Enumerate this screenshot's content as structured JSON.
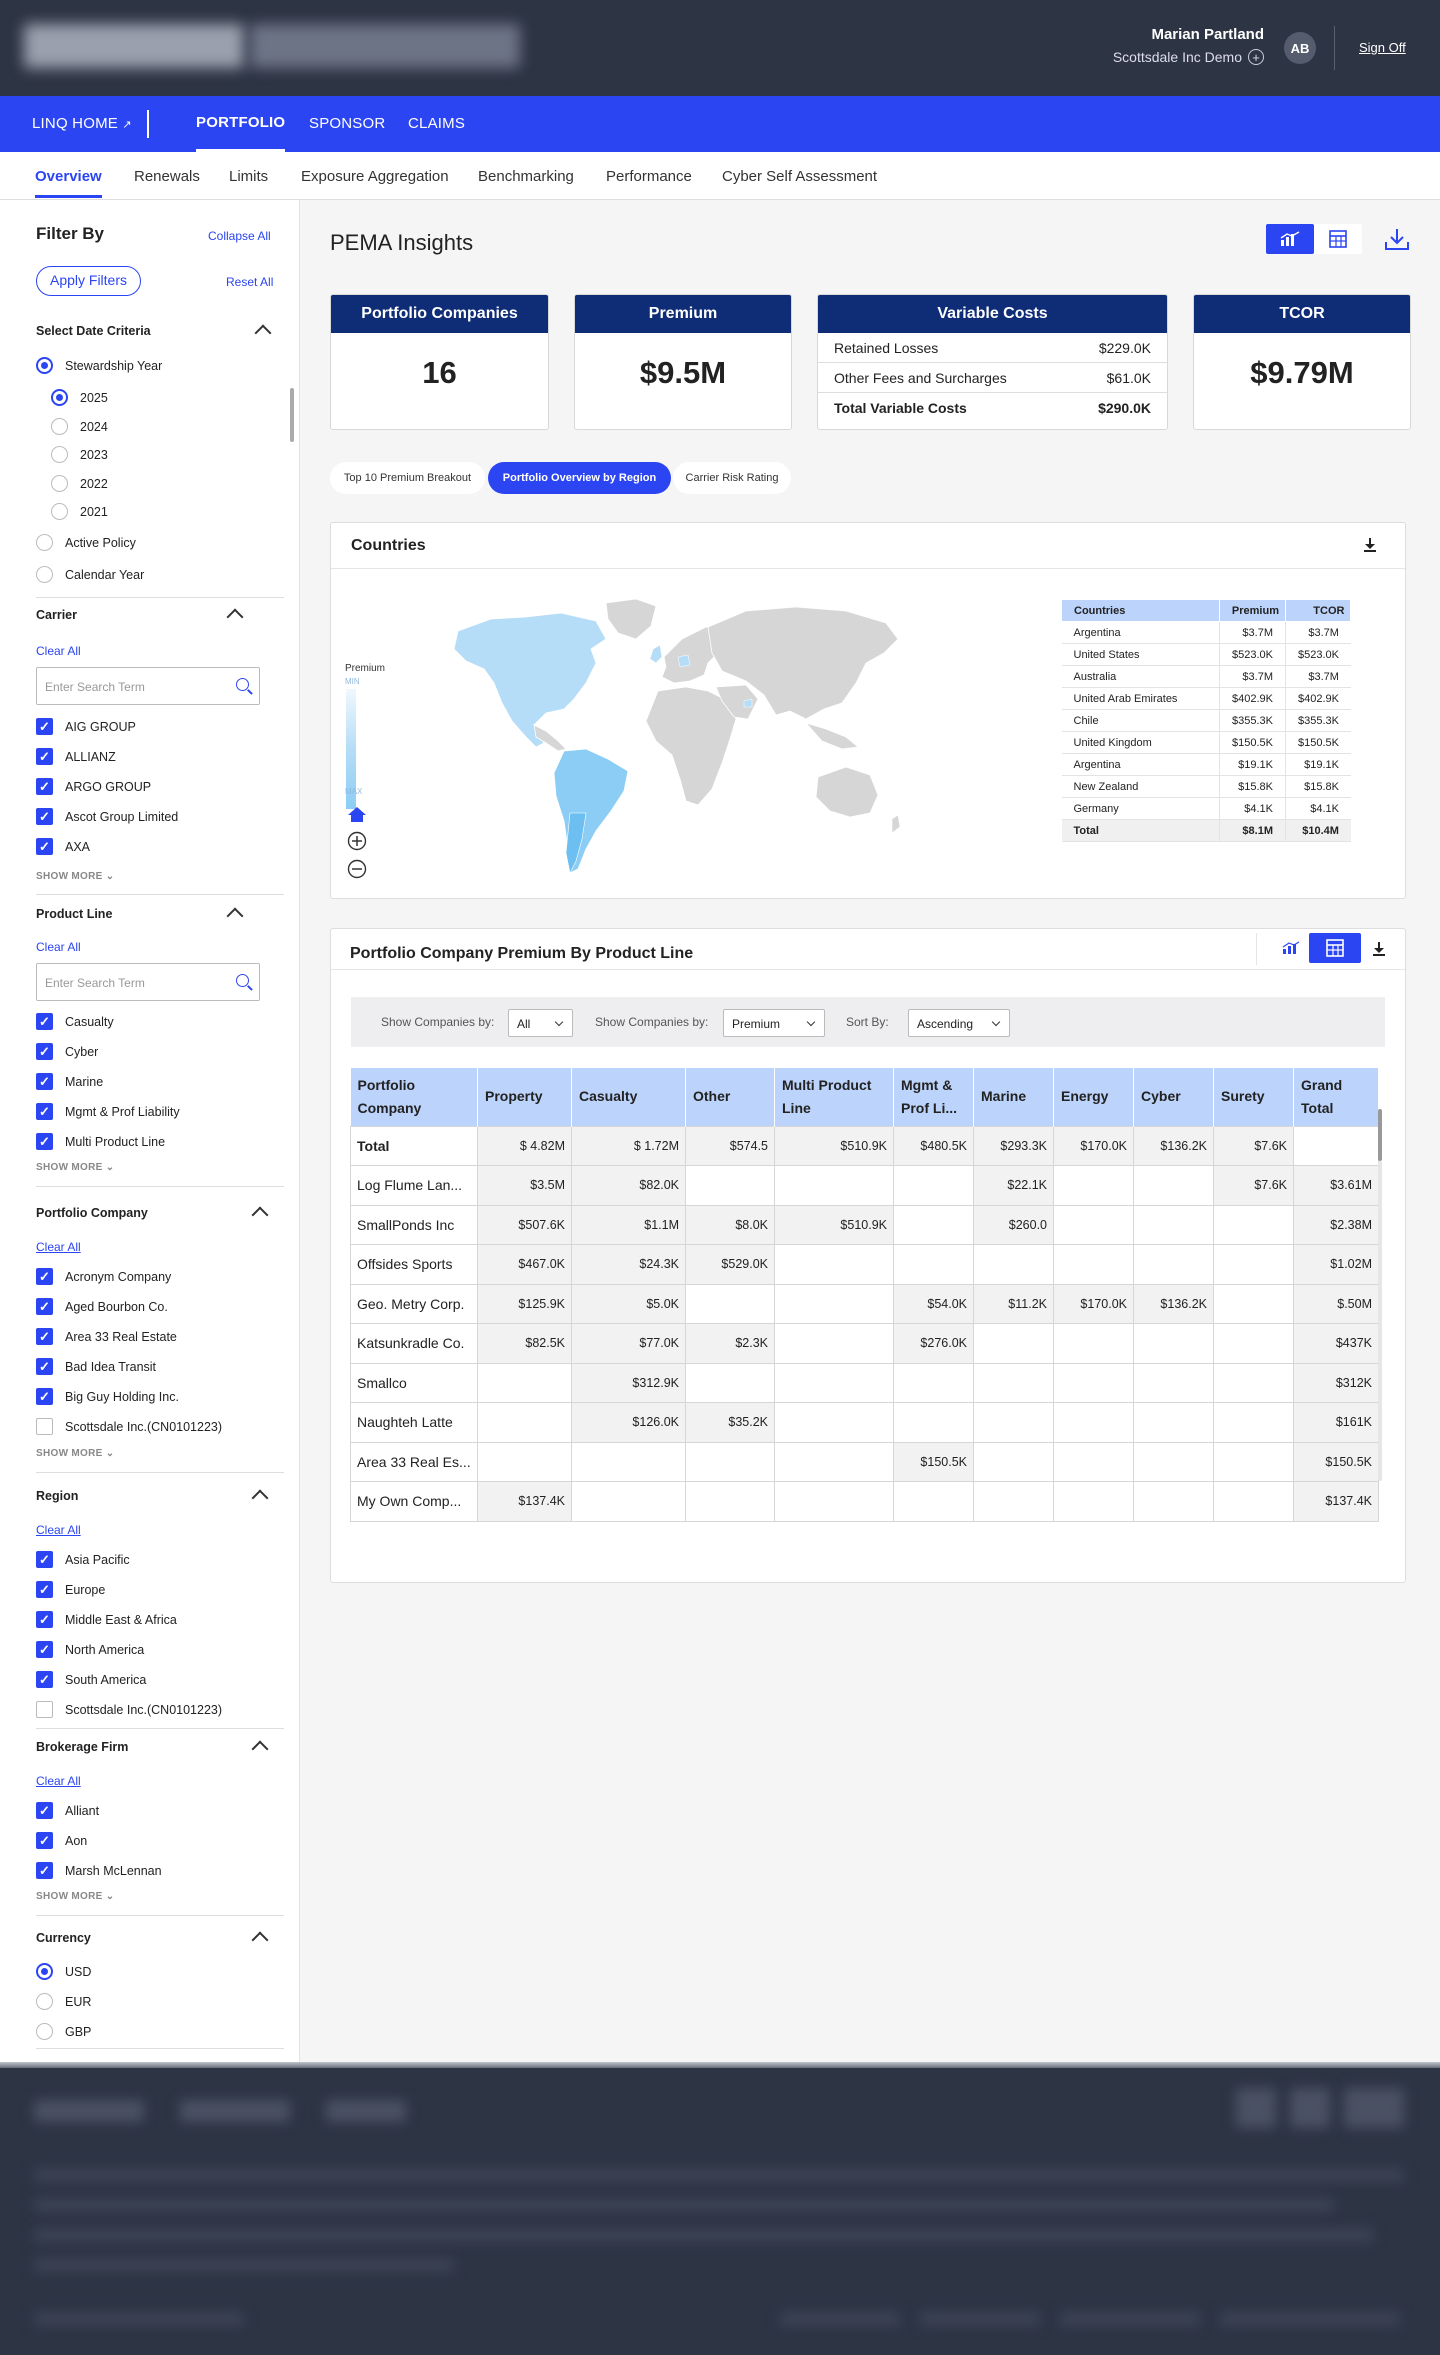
{
  "header": {
    "user_name": "Marian Partland",
    "company": "Scottsdale Inc Demo",
    "avatar": "AB",
    "signoff": "Sign Off"
  },
  "nav": {
    "linq_home": "LINQ HOME",
    "items": [
      "PORTFOLIO",
      "SPONSOR",
      "CLAIMS"
    ],
    "active": "PORTFOLIO"
  },
  "subnav": {
    "items": [
      "Overview",
      "Renewals",
      "Limits",
      "Exposure Aggregation",
      "Benchmarking",
      "Performance",
      "Cyber Self Assessment"
    ],
    "active": "Overview"
  },
  "sidebar": {
    "title": "Filter By",
    "collapse_all": "Collapse All",
    "apply_filters": "Apply Filters",
    "reset_all": "Reset All",
    "clear_all": "Clear All",
    "search_placeholder": "Enter Search Term",
    "show_more": "SHOW MORE",
    "date_criteria": {
      "title": "Select Date Criteria",
      "stewardship": "Stewardship Year",
      "years": [
        "2025",
        "2024",
        "2023",
        "2022",
        "2021"
      ],
      "selected_year": "2025",
      "active_policy": "Active Policy",
      "calendar_year": "Calendar Year"
    },
    "carrier": {
      "title": "Carrier",
      "items": [
        "AIG GROUP",
        "ALLIANZ",
        "ARGO GROUP",
        "Ascot Group Limited",
        "AXA"
      ]
    },
    "product_line": {
      "title": "Product Line",
      "items": [
        "Casualty",
        "Cyber",
        "Marine",
        "Mgmt & Prof Liability",
        "Multi Product Line"
      ]
    },
    "portfolio_company": {
      "title": "Portfolio Company",
      "items": [
        "Acronym Company",
        "Aged Bourbon Co.",
        "Area 33 Real Estate",
        "Bad Idea Transit",
        "Big Guy Holding Inc.",
        "Scottsdale Inc.(CN0101223)"
      ],
      "checked": [
        true,
        true,
        true,
        true,
        true,
        false
      ]
    },
    "region": {
      "title": "Region",
      "items": [
        "Asia Pacific",
        "Europe",
        "Middle East & Africa",
        "North America",
        "South America",
        "Scottsdale Inc.(CN0101223)"
      ],
      "checked": [
        true,
        true,
        true,
        true,
        true,
        false
      ]
    },
    "brokerage": {
      "title": "Brokerage Firm",
      "items": [
        "Alliant",
        "Aon",
        "Marsh McLennan"
      ]
    },
    "currency": {
      "title": "Currency",
      "items": [
        "USD",
        "EUR",
        "GBP"
      ],
      "selected": "USD"
    }
  },
  "main": {
    "title": "PEMA Insights",
    "cards": {
      "portfolio_companies": {
        "label": "Portfolio Companies",
        "value": "16"
      },
      "premium": {
        "label": "Premium",
        "value": "$9.5M"
      },
      "variable_costs": {
        "label": "Variable Costs",
        "rows": [
          {
            "label": "Retained Losses",
            "value": "$229.0K"
          },
          {
            "label": "Other Fees and Surcharges",
            "value": "$61.0K"
          },
          {
            "label": "Total Variable Costs",
            "value": "$290.0K"
          }
        ]
      },
      "tcor": {
        "label": "TCOR",
        "value": "$9.79M"
      }
    },
    "pills": [
      "Top 10 Premium Breakout",
      "Portfolio Overview by Region",
      "Carrier Risk Rating"
    ],
    "active_pill": "Portfolio Overview by Region",
    "countries": {
      "title": "Countries",
      "legend_title": "Premium",
      "legend_min": "MIN",
      "legend_max": "MAX",
      "columns": [
        "Countries",
        "Premium",
        "TCOR"
      ],
      "rows": [
        [
          "Argentina",
          "$3.7M",
          "$3.7M"
        ],
        [
          "United States",
          "$523.0K",
          "$523.0K"
        ],
        [
          "Australia",
          "$3.7M",
          "$3.7M"
        ],
        [
          "United Arab Emirates",
          "$402.9K",
          "$402.9K"
        ],
        [
          "Chile",
          "$355.3K",
          "$355.3K"
        ],
        [
          "United Kingdom",
          "$150.5K",
          "$150.5K"
        ],
        [
          "Argentina",
          "$19.1K",
          "$19.1K"
        ],
        [
          "New Zealand",
          "$15.8K",
          "$15.8K"
        ],
        [
          "Germany",
          "$4.1K",
          "$4.1K"
        ]
      ],
      "total": [
        "Total",
        "$8.1M",
        "$10.4M"
      ]
    },
    "product_line": {
      "title": "Portfolio Company Premium By Product Line",
      "filters": {
        "show_by_label": "Show Companies by:",
        "show_by_value": "All",
        "show_by2_label": "Show Companies by:",
        "show_by2_value": "Premium",
        "sort_label": "Sort By:",
        "sort_value": "Ascending"
      },
      "columns": [
        "Portfolio Company",
        "Property",
        "Casualty",
        "Other",
        "Multi Product Line",
        "Mgmt & Prof Li...",
        "Marine",
        "Energy",
        "Cyber",
        "Surety",
        "Grand Total"
      ],
      "rows": [
        [
          "Total",
          "$ 4.82M",
          "$ 1.72M",
          "$574.5",
          "$510.9K",
          "$480.5K",
          "$293.3K",
          "$170.0K",
          "$136.2K",
          "$7.6K",
          ""
        ],
        [
          "Log Flume Lan...",
          "$3.5M",
          "$82.0K",
          "",
          "",
          "",
          "$22.1K",
          "",
          "",
          "$7.6K",
          "$3.61M"
        ],
        [
          "SmallPonds Inc",
          "$507.6K",
          "$1.1M",
          "$8.0K",
          "$510.9K",
          "",
          "$260.0",
          "",
          "",
          "",
          "$2.38M"
        ],
        [
          "Offsides Sports",
          "$467.0K",
          "$24.3K",
          "$529.0K",
          "",
          "",
          "",
          "",
          "",
          "",
          "$1.02M"
        ],
        [
          "Geo. Metry Corp.",
          "$125.9K",
          "$5.0K",
          "",
          "",
          "$54.0K",
          "$11.2K",
          "$170.0K",
          "$136.2K",
          "",
          "$.50M"
        ],
        [
          "Katsunkradle Co.",
          "$82.5K",
          "$77.0K",
          "$2.3K",
          "",
          "$276.0K",
          "",
          "",
          "",
          "",
          "$437K"
        ],
        [
          "Smallco",
          "",
          "$312.9K",
          "",
          "",
          "",
          "",
          "",
          "",
          "",
          "$312K"
        ],
        [
          "Naughteh Latte",
          "",
          "$126.0K",
          "$35.2K",
          "",
          "",
          "",
          "",
          "",
          "",
          "$161K"
        ],
        [
          "Area 33 Real Es...",
          "",
          "",
          "",
          "",
          "$150.5K",
          "",
          "",
          "",
          "",
          "$150.5K"
        ],
        [
          "My Own Comp...",
          "$137.4K",
          "",
          "",
          "",
          "",
          "",
          "",
          "",
          "",
          "$137.4K"
        ]
      ]
    }
  },
  "colors": {
    "brand_blue": "#2b45f2",
    "navy": "#0f2d77",
    "header_bg": "#2d3444",
    "map_light": "#b5ddf7",
    "map_dark": "#6cbff0",
    "map_grey": "#d6d6d6"
  }
}
